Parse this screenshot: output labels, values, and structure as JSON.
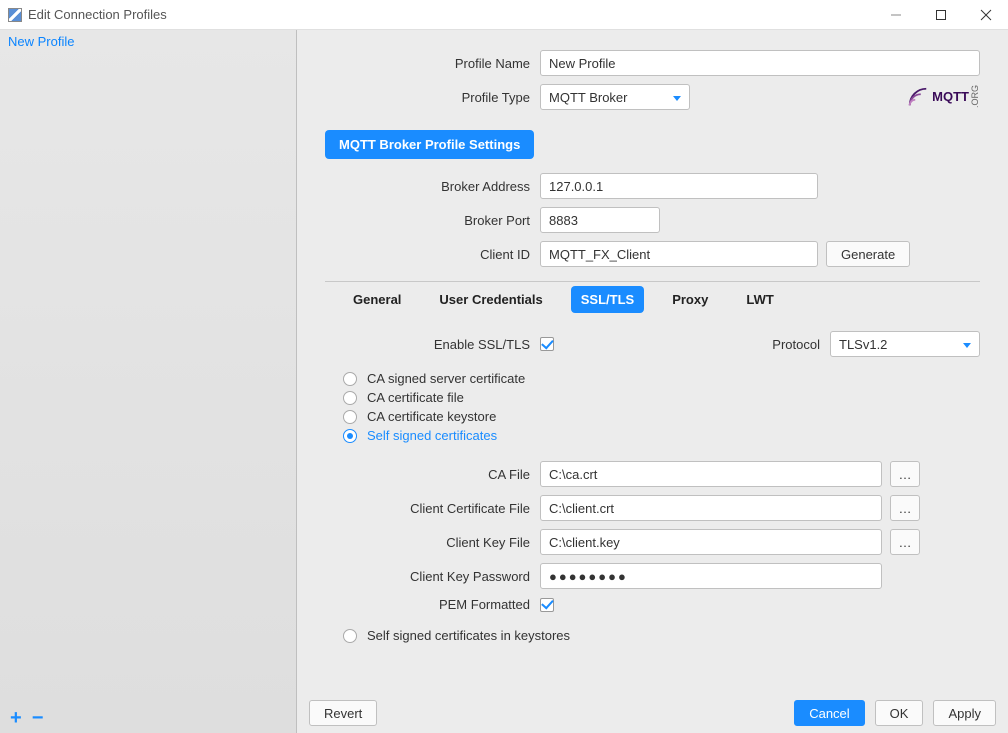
{
  "window": {
    "title": "Edit Connection Profiles"
  },
  "sidebar": {
    "profiles": [
      "New Profile"
    ],
    "add_label": "+",
    "remove_label": "−"
  },
  "logo": {
    "text": "MQTT",
    "sub": ".ORG"
  },
  "fields": {
    "profile_name_label": "Profile Name",
    "profile_name_value": "New Profile",
    "profile_type_label": "Profile Type",
    "profile_type_value": "MQTT Broker",
    "section_title": "MQTT Broker Profile Settings",
    "broker_address_label": "Broker Address",
    "broker_address_value": "127.0.0.1",
    "broker_port_label": "Broker Port",
    "broker_port_value": "8883",
    "client_id_label": "Client ID",
    "client_id_value": "MQTT_FX_Client",
    "generate_label": "Generate"
  },
  "tabs": {
    "items": [
      "General",
      "User Credentials",
      "SSL/TLS",
      "Proxy",
      "LWT"
    ],
    "active": "SSL/TLS"
  },
  "ssl": {
    "enable_label": "Enable SSL/TLS",
    "enable_checked": true,
    "protocol_label": "Protocol",
    "protocol_value": "TLSv1.2",
    "radio_options": [
      "CA signed server certificate",
      "CA certificate file",
      "CA certificate keystore",
      "Self signed certificates"
    ],
    "radio_active_index": 3,
    "ca_file_label": "CA File",
    "ca_file_value": "C:\\ca.crt",
    "client_cert_label": "Client Certificate File",
    "client_cert_value": "C:\\client.crt",
    "client_key_label": "Client Key File",
    "client_key_value": "C:\\client.key",
    "client_key_pw_label": "Client Key Password",
    "client_key_pw_value": "●●●●●●●●",
    "pem_label": "PEM Formatted",
    "pem_checked": true,
    "keystore_radio_label": "Self signed certificates in keystores",
    "browse_label": "…"
  },
  "footer": {
    "revert": "Revert",
    "cancel": "Cancel",
    "ok": "OK",
    "apply": "Apply"
  }
}
